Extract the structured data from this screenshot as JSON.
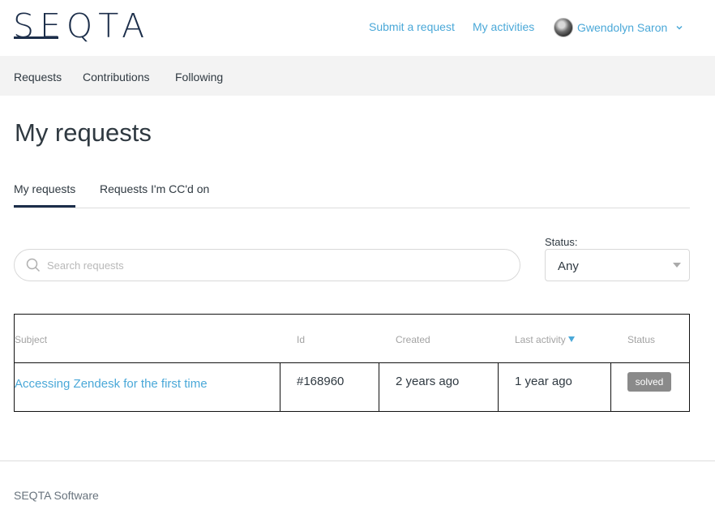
{
  "header": {
    "logo": "SEQTA",
    "submit_link": "Submit a request",
    "activities_link": "My activities",
    "user_name": "Gwendolyn Saron"
  },
  "subnav": {
    "items": [
      "Requests",
      "Contributions",
      "Following"
    ],
    "active": "Requests"
  },
  "page_title": "My requests",
  "tabs": {
    "items": [
      "My requests",
      "Requests I'm CC'd on"
    ],
    "active": "My requests"
  },
  "search": {
    "placeholder": "Search requests",
    "value": ""
  },
  "status_filter": {
    "label": "Status:",
    "selected": "Any"
  },
  "table": {
    "columns": [
      "Subject",
      "Id",
      "Created",
      "Last activity",
      "Status"
    ],
    "sorted_column": "Last activity",
    "rows": [
      {
        "subject": "Accessing Zendesk for the first time",
        "id": "#168960",
        "created": "2 years ago",
        "last_activity": "1 year ago",
        "status": "solved"
      }
    ]
  },
  "footer": {
    "text": "SEQTA Software"
  },
  "colors": {
    "brand_navy": "#1c2e4a",
    "link_blue": "#4aa8d8",
    "badge_gray": "#8a8a8a"
  }
}
